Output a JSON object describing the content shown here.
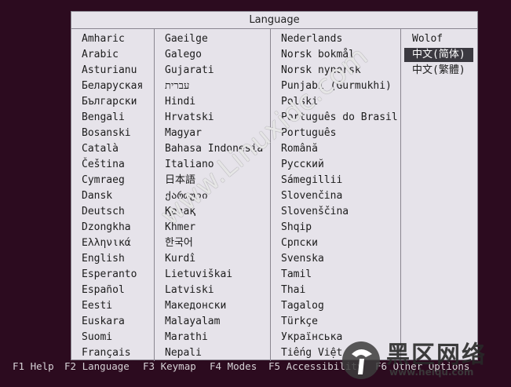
{
  "dialog": {
    "title": "Language",
    "columns": [
      [
        "Amharic",
        "Arabic",
        "Asturianu",
        "Беларуская",
        "Български",
        "Bengali",
        "Bosanski",
        "Català",
        "Čeština",
        "Cymraeg",
        "Dansk",
        "Deutsch",
        "Dzongkha",
        "Ελληνικά",
        "English",
        "Esperanto",
        "Español",
        "Eesti",
        "Euskara",
        "Suomi",
        "Français"
      ],
      [
        "Gaeilge",
        "Galego",
        "Gujarati",
        "עברית",
        "Hindi",
        "Hrvatski",
        "Magyar",
        "Bahasa Indonesia",
        "Italiano",
        "日本語",
        "ქართული",
        "Қазақ",
        "Khmer",
        "한국어",
        "Kurdî",
        "Lietuviškai",
        "Latviski",
        "Македонски",
        "Malayalam",
        "Marathi",
        "Nepali"
      ],
      [
        "Nederlands",
        "Norsk bokmål",
        "Norsk nynorsk",
        "Punjabi (Gurmukhi)",
        "Polski",
        "Português do Brasil",
        "Português",
        "Română",
        "Русский",
        "Sámegillii",
        "Slovenčina",
        "Slovenščina",
        "Shqip",
        "Српски",
        "Svenska",
        "Tamil",
        "Thai",
        "Tagalog",
        "Türkçe",
        "Українська",
        "Tiếng Việt"
      ],
      [
        "Wolof",
        "中文(简体)",
        "中文(繁體)"
      ]
    ],
    "selected": "中文(简体)"
  },
  "fkeys": [
    {
      "key": "F1",
      "label": "Help"
    },
    {
      "key": "F2",
      "label": "Language"
    },
    {
      "key": "F3",
      "label": "Keymap"
    },
    {
      "key": "F4",
      "label": "Modes"
    },
    {
      "key": "F5",
      "label": "Accessibility"
    },
    {
      "key": "F6",
      "label": "Other Options"
    }
  ],
  "watermark": "www.Linuxidc.com",
  "logo": {
    "text": "黑区网络",
    "url": "www.heiqu.com"
  },
  "colors": {
    "background": "#2c0b1f",
    "dialog": "#e6e3ea",
    "selection": "#3b3940",
    "fkey_text": "#d6d2d6"
  }
}
